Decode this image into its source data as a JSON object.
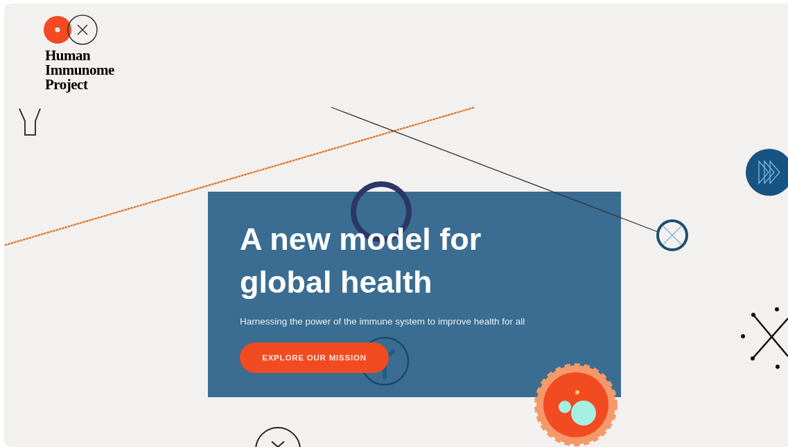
{
  "logo": {
    "lines": [
      "Human",
      "Immunome",
      "Project"
    ]
  },
  "hero": {
    "title_lines": [
      "A new model for",
      "global health"
    ],
    "subtitle": "Harnessing the power of the immune system to improve health for all",
    "button": "EXPLORE OUR MISSION"
  }
}
